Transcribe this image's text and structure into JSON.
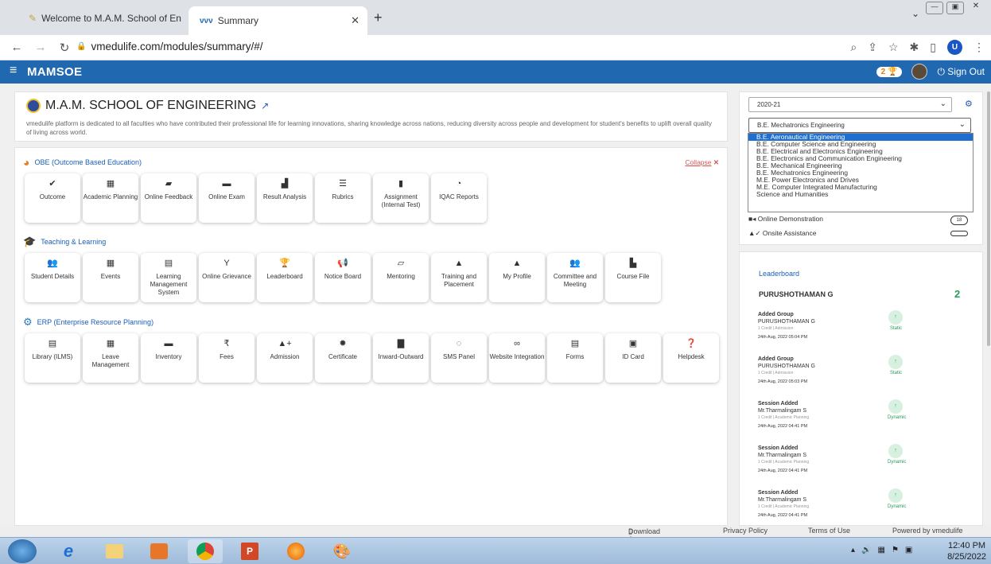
{
  "browser": {
    "tabs": [
      {
        "label": "Welcome to M.A.M. School of En",
        "active": false
      },
      {
        "label": "Summary",
        "active": true
      }
    ],
    "new_tab": "+",
    "url": "vmedulife.com/modules/summary/#/",
    "profile_initial": "U",
    "window_controls": [
      "minimize",
      "maximize",
      "close"
    ]
  },
  "app": {
    "brand": "MAMSOE",
    "notif_count": "2",
    "signout": "Sign Out"
  },
  "school": {
    "name": "M.A.M. SCHOOL OF ENGINEERING",
    "description": "vmedulife platform is dedicated to all faculties who have contributed their professional life for learning innovations, sharing knowledge across nations, reducing diversity across people and development for student's benefits to uplift overall quality of living across world."
  },
  "obe": {
    "title": "OBE (Outcome Based Education)",
    "collapse": "Collapse",
    "tiles": [
      {
        "label": "Outcome",
        "icon": "check-icon",
        "glyph": "✔"
      },
      {
        "label": "Academic Planning",
        "icon": "calendar-icon",
        "glyph": "▦"
      },
      {
        "label": "Online Feedback",
        "icon": "chat-icon",
        "glyph": "▰"
      },
      {
        "label": "Online Exam",
        "icon": "folder-icon",
        "glyph": "▬"
      },
      {
        "label": "Result Analysis",
        "icon": "chart-icon",
        "glyph": "▟"
      },
      {
        "label": "Rubrics",
        "icon": "list-icon",
        "glyph": "☰"
      },
      {
        "label": "Assignment (Internal Test)",
        "icon": "book-icon",
        "glyph": "▮"
      },
      {
        "label": "IQAC Reports",
        "icon": "pie-chart-icon",
        "glyph": "◔"
      }
    ]
  },
  "teaching": {
    "title": "Teaching & Learning",
    "tiles": [
      {
        "label": "Student Details",
        "icon": "users-icon",
        "glyph": "👥"
      },
      {
        "label": "Events",
        "icon": "calendar-check-icon",
        "glyph": "▦"
      },
      {
        "label": "Learning Management System",
        "icon": "book-icon",
        "glyph": "▤"
      },
      {
        "label": "Online Grievance",
        "icon": "cocktail-icon",
        "glyph": "Y"
      },
      {
        "label": "Leaderboard",
        "icon": "trophy-icon",
        "glyph": "🏆"
      },
      {
        "label": "Notice Board",
        "icon": "megaphone-icon",
        "glyph": "📢"
      },
      {
        "label": "Mentoring",
        "icon": "chalkboard-icon",
        "glyph": "▱"
      },
      {
        "label": "Training and Placement",
        "icon": "user-tie-icon",
        "glyph": "▲"
      },
      {
        "label": "My Profile",
        "icon": "user-icon",
        "glyph": "▲"
      },
      {
        "label": "Committee and Meeting",
        "icon": "group-icon",
        "glyph": "👥"
      },
      {
        "label": "Course File",
        "icon": "edit-file-icon",
        "glyph": "▙"
      }
    ]
  },
  "erp": {
    "title": "ERP (Enterprise Resource Planning)",
    "tiles": [
      {
        "label": "Library (ILMS)",
        "icon": "library-icon",
        "glyph": "▤"
      },
      {
        "label": "Leave Management",
        "icon": "calendar-icon",
        "glyph": "▦"
      },
      {
        "label": "Inventory",
        "icon": "box-icon",
        "glyph": "▬"
      },
      {
        "label": "Fees",
        "icon": "rupee-icon",
        "glyph": "₹"
      },
      {
        "label": "Admission",
        "icon": "user-plus-icon",
        "glyph": "▲+"
      },
      {
        "label": "Certificate",
        "icon": "certificate-icon",
        "glyph": "✹"
      },
      {
        "label": "Inward-Outward",
        "icon": "file-icon",
        "glyph": "▇"
      },
      {
        "label": "SMS Panel",
        "icon": "message-icon",
        "glyph": "◌"
      },
      {
        "label": "Website Integration",
        "icon": "link-icon",
        "glyph": "∞"
      },
      {
        "label": "Forms",
        "icon": "form-icon",
        "glyph": "▤"
      },
      {
        "label": "ID Card",
        "icon": "id-card-icon",
        "glyph": "▣"
      },
      {
        "label": "Helpdesk",
        "icon": "question-icon",
        "glyph": "❓"
      }
    ]
  },
  "sidebar": {
    "year": "2020-21",
    "program_selected": "B.E. Mechatronics Engineering",
    "program_options": [
      "B.E. Aeronautical Engineering",
      "B.E. Computer Science and Engineering",
      "B.E. Electrical and Electronics Engineering",
      "B.E. Electronics and Communication Engineering",
      "B.E. Mechanical Engineering",
      "B.E. Mechatronics Engineering",
      "M.E. Power Electronics and Drives",
      "M.E. Computer Integrated Manufacturing",
      "Science and Humanities"
    ],
    "highlighted_option": "B.E. Aeronautical Engineering",
    "online_demo": "Online Demonstration",
    "online_demo_count": "18",
    "onsite": "Onsite Assistance",
    "onsite_count": ""
  },
  "leaderboard": {
    "title": "Leaderboard",
    "leader_name": "PURUSHOTHAMAN G",
    "leader_score": "2",
    "items": [
      {
        "action": "Added Group",
        "name": "PURUSHOTHAMAN G",
        "meta": "1 Credit | Admission",
        "time": "24th Aug, 2022 05:04 PM",
        "kind": "Static"
      },
      {
        "action": "Added Group",
        "name": "PURUSHOTHAMAN G",
        "meta": "1 Credit | Admission",
        "time": "24th Aug, 2022 05:03 PM",
        "kind": "Static"
      },
      {
        "action": "Session Added",
        "name": "Mr.Tharmalingam S",
        "meta": "1 Credit | Academic Planning",
        "time": "24th Aug, 2022 04:41 PM",
        "kind": "Dynamic"
      },
      {
        "action": "Session Added",
        "name": "Mr.Tharmalingam S",
        "meta": "1 Credit | Academic Planning",
        "time": "24th Aug, 2022 04:41 PM",
        "kind": "Dynamic"
      },
      {
        "action": "Session Added",
        "name": "Mr.Tharmalingam S",
        "meta": "1 Credit | Academic Planning",
        "time": "24th Aug, 2022 04:41 PM",
        "kind": "Dynamic"
      }
    ]
  },
  "footer": {
    "download": "Download App",
    "privacy": "Privacy Policy",
    "terms": "Terms of Use",
    "powered": "Powered by vmedulife"
  },
  "taskbar": {
    "time": "12:40 PM",
    "date": "8/25/2022",
    "apps": [
      "ie-icon",
      "explorer-icon",
      "media-player-icon",
      "chrome-icon",
      "powerpoint-icon",
      "firefox-icon",
      "paint-icon"
    ]
  },
  "colors": {
    "brand_blue": "#2068b0",
    "accent_red": "#d9534f",
    "link_blue": "#1a5db8",
    "highlight": "#1e6fd0"
  }
}
